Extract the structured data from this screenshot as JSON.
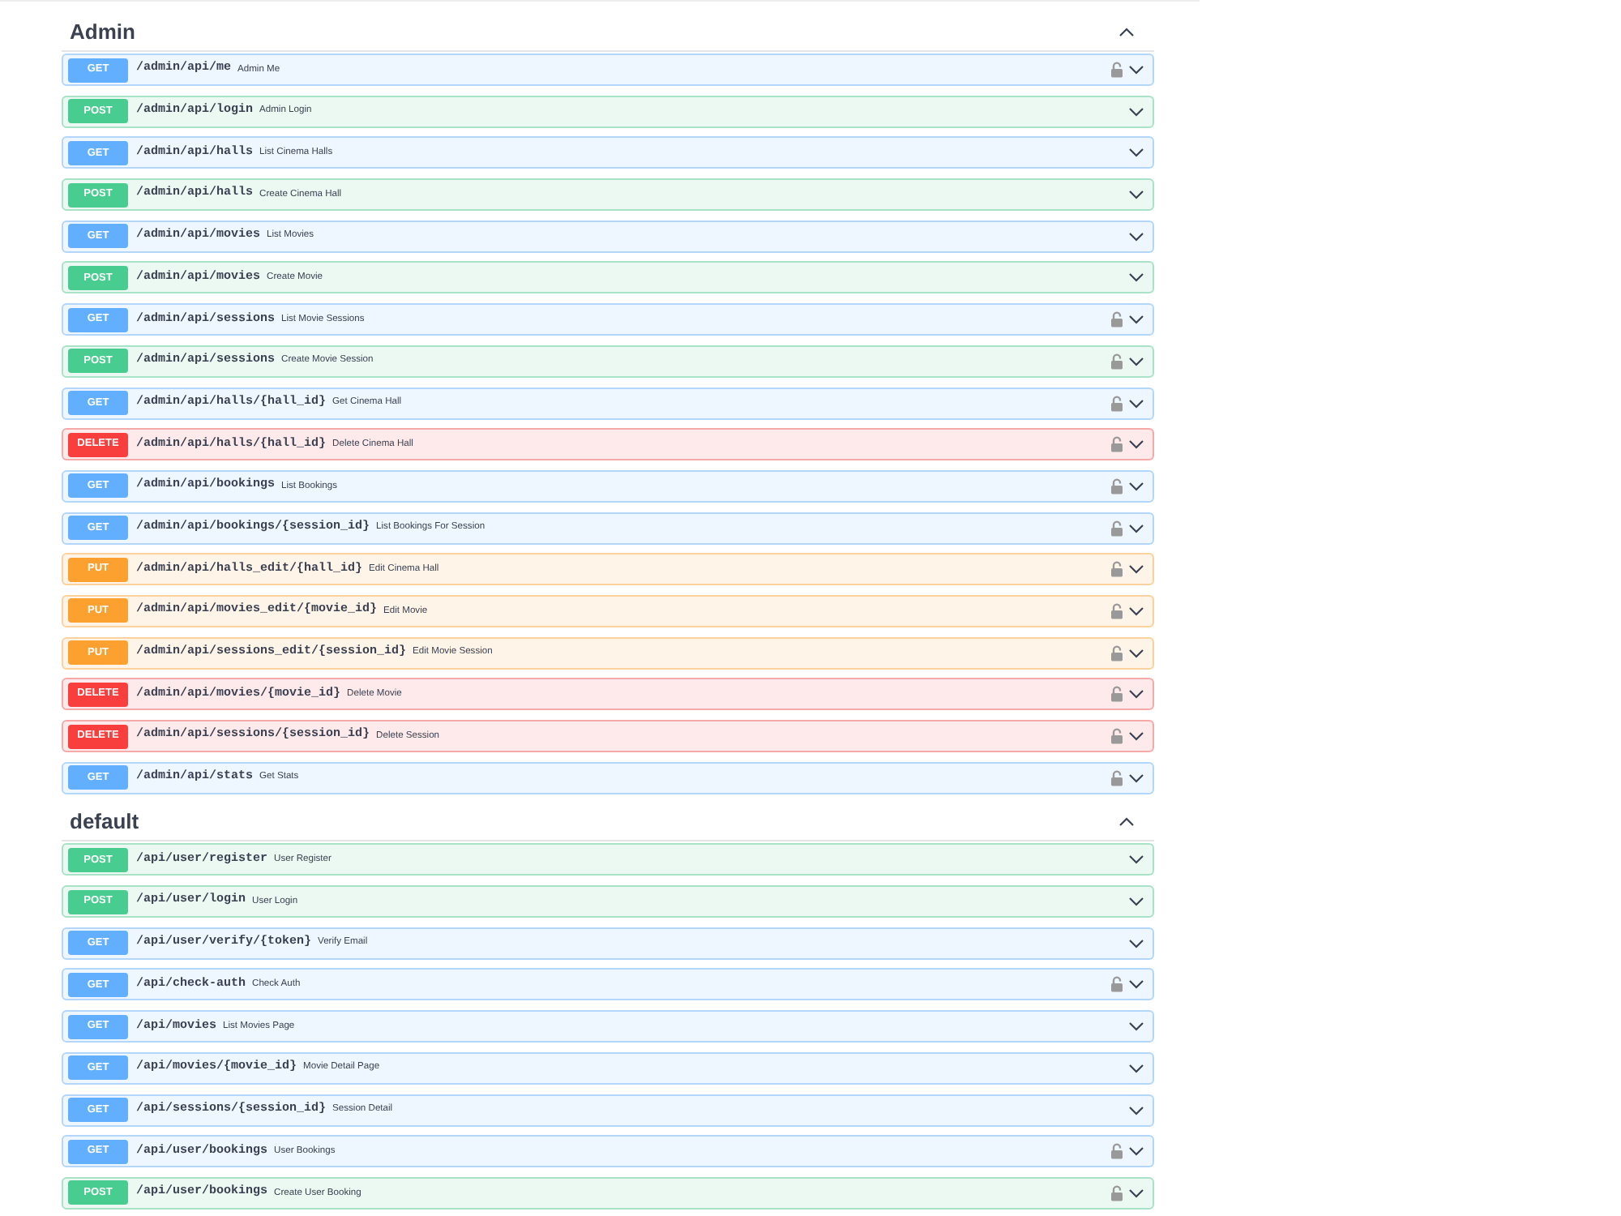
{
  "sections": [
    {
      "title": "Admin",
      "expanded": true,
      "operations": [
        {
          "kind": "get",
          "method": "GET",
          "path": "/admin/api/me",
          "summary": "Admin Me",
          "auth_required": true
        },
        {
          "kind": "post",
          "method": "POST",
          "path": "/admin/api/login",
          "summary": "Admin Login",
          "auth_required": false
        },
        {
          "kind": "get",
          "method": "GET",
          "path": "/admin/api/halls",
          "summary": "List Cinema Halls",
          "auth_required": false
        },
        {
          "kind": "post",
          "method": "POST",
          "path": "/admin/api/halls",
          "summary": "Create Cinema Hall",
          "auth_required": false
        },
        {
          "kind": "get",
          "method": "GET",
          "path": "/admin/api/movies",
          "summary": "List Movies",
          "auth_required": false
        },
        {
          "kind": "post",
          "method": "POST",
          "path": "/admin/api/movies",
          "summary": "Create Movie",
          "auth_required": false
        },
        {
          "kind": "get",
          "method": "GET",
          "path": "/admin/api/sessions",
          "summary": "List Movie Sessions",
          "auth_required": true
        },
        {
          "kind": "post",
          "method": "POST",
          "path": "/admin/api/sessions",
          "summary": "Create Movie Session",
          "auth_required": true
        },
        {
          "kind": "get",
          "method": "GET",
          "path": "/admin/api/halls/{hall_id}",
          "summary": "Get Cinema Hall",
          "auth_required": true
        },
        {
          "kind": "delete",
          "method": "DELETE",
          "path": "/admin/api/halls/{hall_id}",
          "summary": "Delete Cinema Hall",
          "auth_required": true
        },
        {
          "kind": "get",
          "method": "GET",
          "path": "/admin/api/bookings",
          "summary": "List Bookings",
          "auth_required": true
        },
        {
          "kind": "get",
          "method": "GET",
          "path": "/admin/api/bookings/{session_id}",
          "summary": "List Bookings For Session",
          "auth_required": true
        },
        {
          "kind": "put",
          "method": "PUT",
          "path": "/admin/api/halls_edit/{hall_id}",
          "summary": "Edit Cinema Hall",
          "auth_required": true
        },
        {
          "kind": "put",
          "method": "PUT",
          "path": "/admin/api/movies_edit/{movie_id}",
          "summary": "Edit Movie",
          "auth_required": true
        },
        {
          "kind": "put",
          "method": "PUT",
          "path": "/admin/api/sessions_edit/{session_id}",
          "summary": "Edit Movie Session",
          "auth_required": true
        },
        {
          "kind": "delete",
          "method": "DELETE",
          "path": "/admin/api/movies/{movie_id}",
          "summary": "Delete Movie",
          "auth_required": true
        },
        {
          "kind": "delete",
          "method": "DELETE",
          "path": "/admin/api/sessions/{session_id}",
          "summary": "Delete Session",
          "auth_required": true
        },
        {
          "kind": "get",
          "method": "GET",
          "path": "/admin/api/stats",
          "summary": "Get Stats",
          "auth_required": true
        }
      ]
    },
    {
      "title": "default",
      "expanded": true,
      "operations": [
        {
          "kind": "post",
          "method": "POST",
          "path": "/api/user/register",
          "summary": "User Register",
          "auth_required": false
        },
        {
          "kind": "post",
          "method": "POST",
          "path": "/api/user/login",
          "summary": "User Login",
          "auth_required": false
        },
        {
          "kind": "get",
          "method": "GET",
          "path": "/api/user/verify/{token}",
          "summary": "Verify Email",
          "auth_required": false
        },
        {
          "kind": "get",
          "method": "GET",
          "path": "/api/check-auth",
          "summary": "Check Auth",
          "auth_required": true
        },
        {
          "kind": "get",
          "method": "GET",
          "path": "/api/movies",
          "summary": "List Movies Page",
          "auth_required": false
        },
        {
          "kind": "get",
          "method": "GET",
          "path": "/api/movies/{movie_id}",
          "summary": "Movie Detail Page",
          "auth_required": false
        },
        {
          "kind": "get",
          "method": "GET",
          "path": "/api/sessions/{session_id}",
          "summary": "Session Detail",
          "auth_required": false
        },
        {
          "kind": "get",
          "method": "GET",
          "path": "/api/user/bookings",
          "summary": "User Bookings",
          "auth_required": true
        },
        {
          "kind": "post",
          "method": "POST",
          "path": "/api/user/bookings",
          "summary": "Create User Booking",
          "auth_required": true
        }
      ]
    }
  ]
}
